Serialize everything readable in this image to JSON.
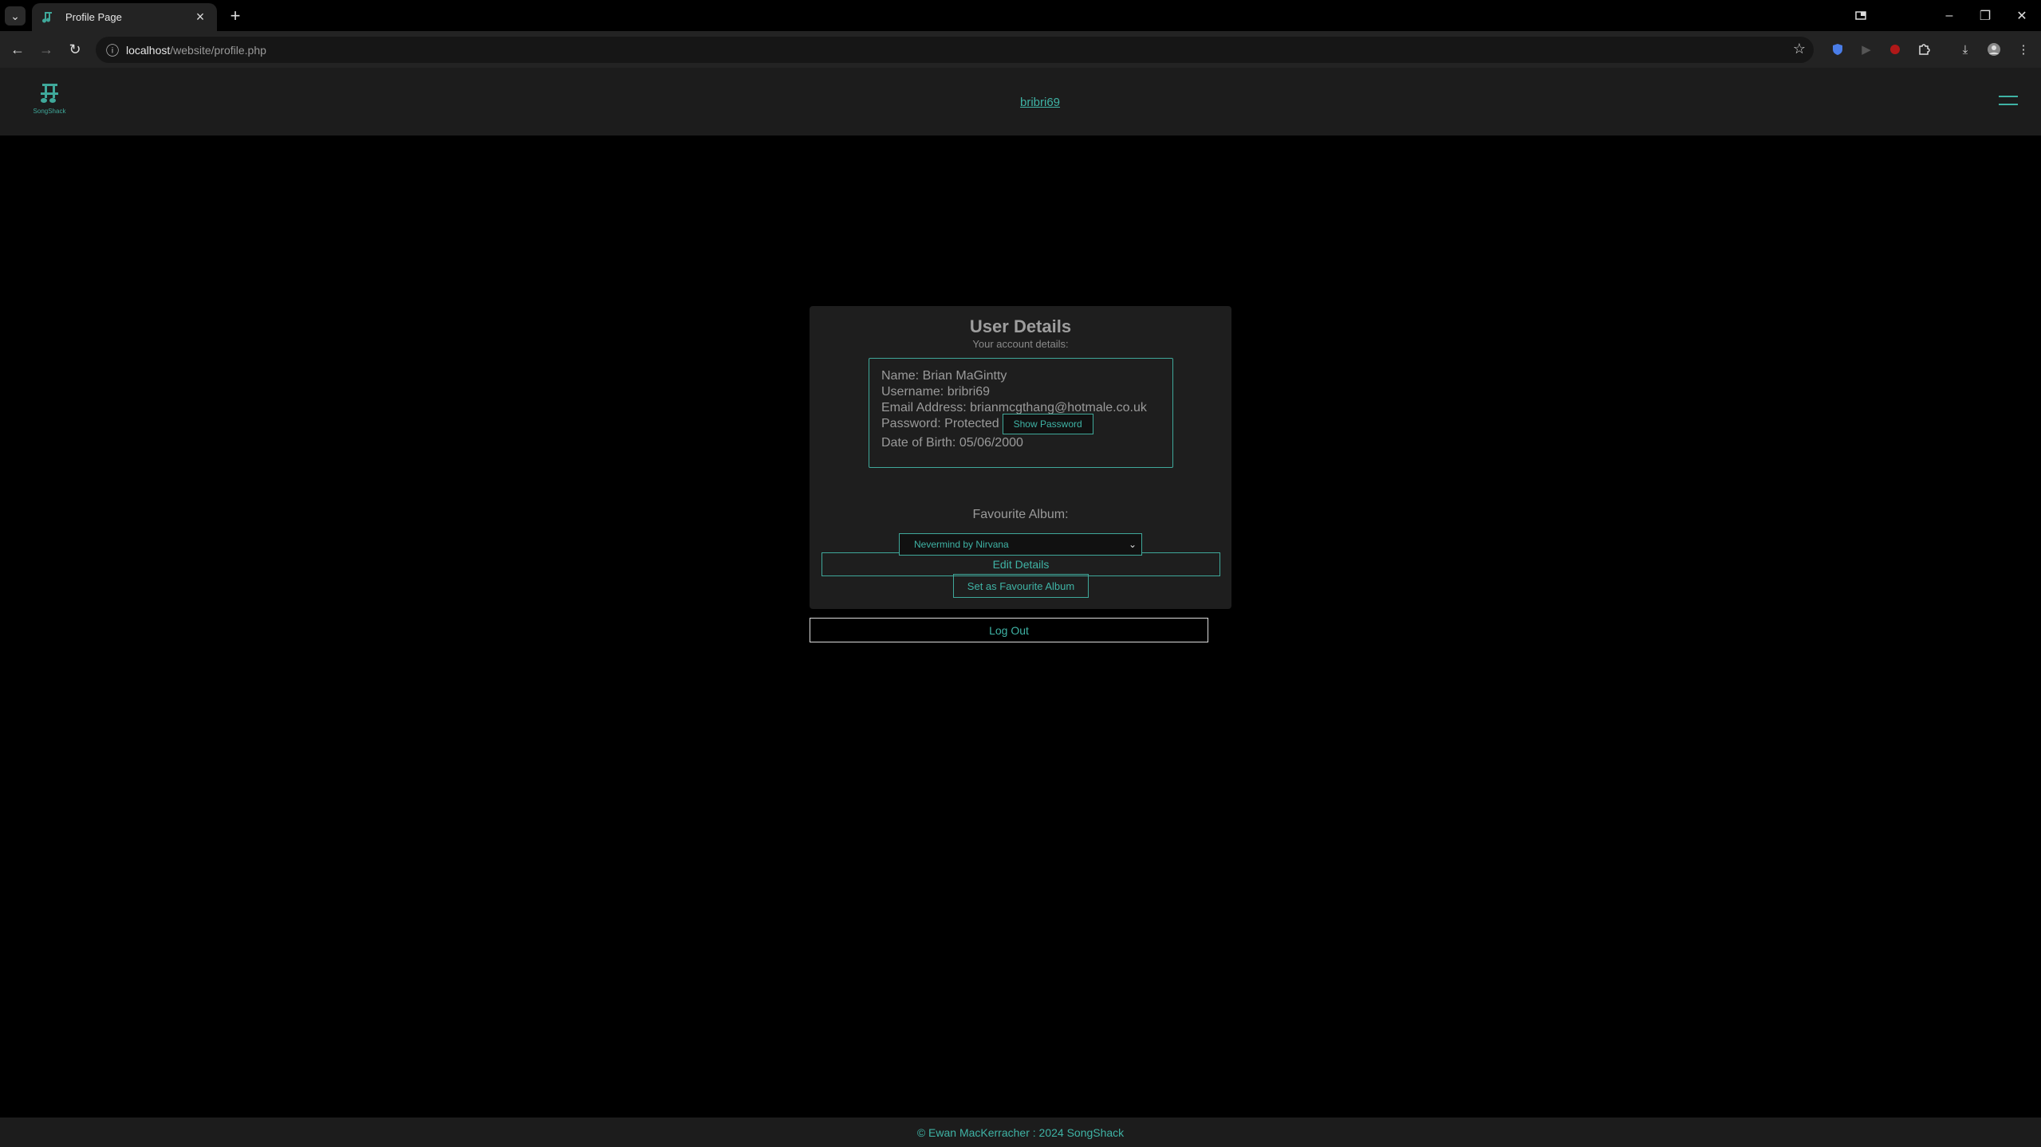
{
  "browser": {
    "tab_title": "Profile Page",
    "url_host": "localhost",
    "url_path": "/website/profile.php"
  },
  "header": {
    "logo_text": "SongShack",
    "username_link": "bribri69"
  },
  "card": {
    "title": "User Details",
    "subtitle": "Your account details:",
    "details": {
      "name": "Name: Brian MaGintty",
      "username": "Username: bribri69",
      "email": "Email Address: brianmcgthang@hotmale.co.uk",
      "password": "Password: Protected",
      "dob": "Date of Birth: 05/06/2000"
    },
    "show_password_label": "Show Password",
    "edit_details_label": "Edit Details",
    "favourite_label": "Favourite Album:",
    "favourite_selected": "Nevermind by Nirvana",
    "set_favourite_label": "Set as Favourite Album"
  },
  "logout_label": "Log Out",
  "footer": {
    "text": "© Ewan MacKerracher : 2024 SongShack"
  },
  "colors": {
    "accent": "#3fb3a5",
    "card_bg": "#1e1e1e",
    "header_bg": "#1c1c1c",
    "page_bg": "#000000"
  }
}
